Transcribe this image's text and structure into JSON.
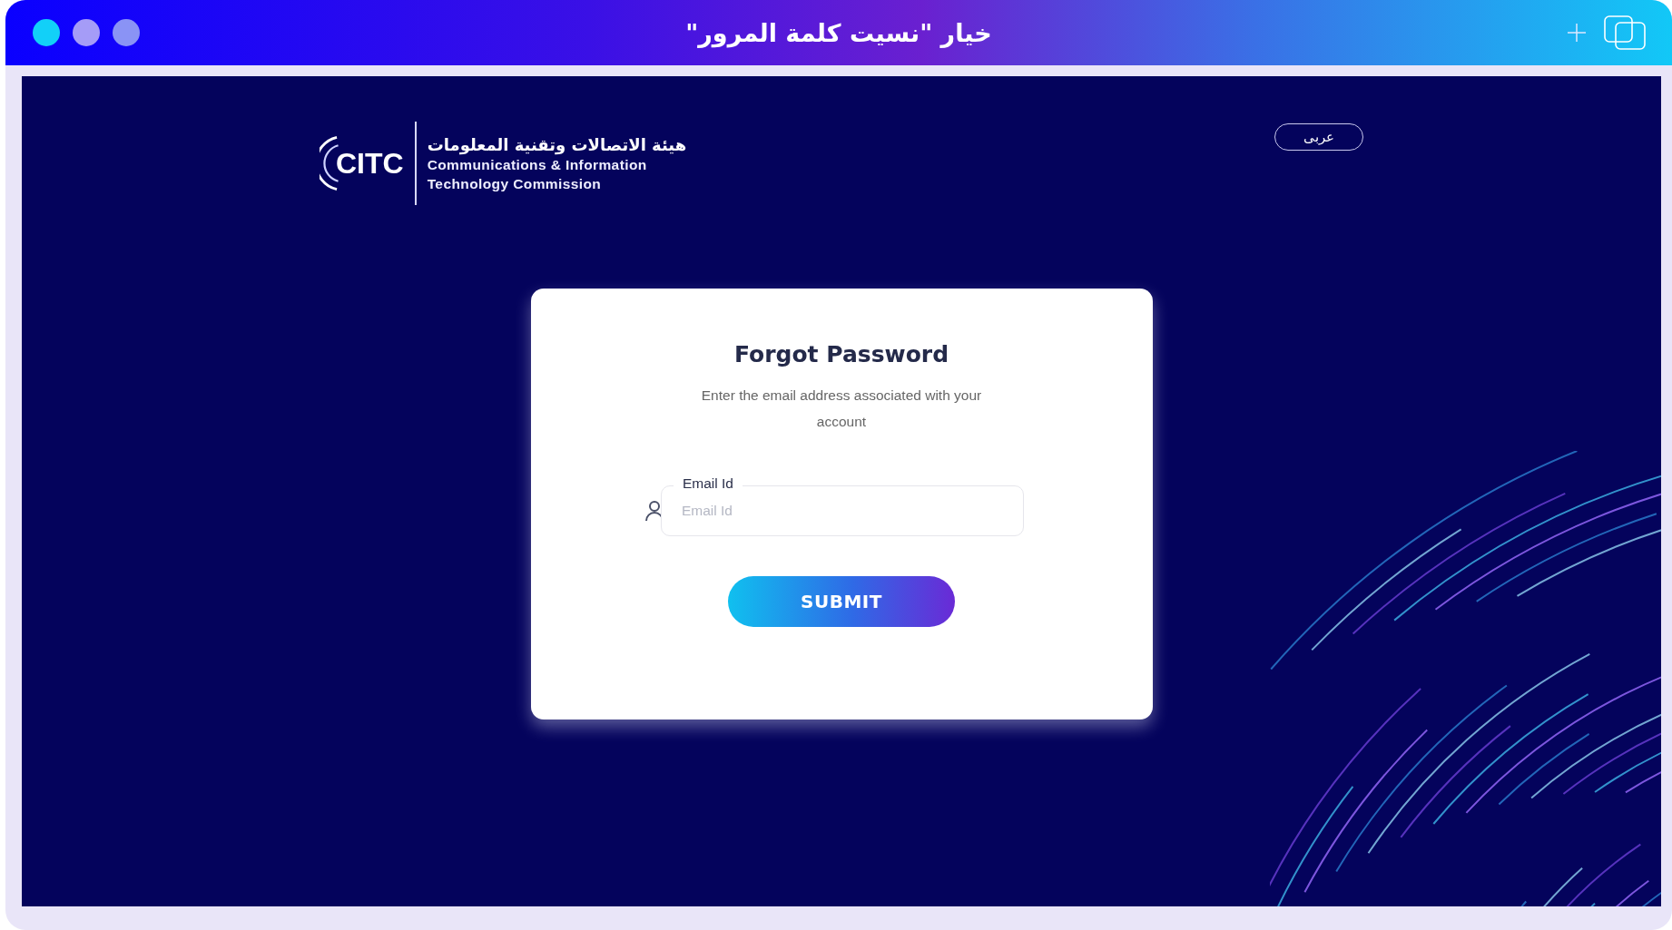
{
  "window": {
    "title": "خيار \"نسيت كلمة المرور\""
  },
  "header": {
    "logo": {
      "mark": "CITC",
      "name_ar": "هيئة الاتصالات وتقنية المعلومات",
      "name_en_line1": "Communications & Information",
      "name_en_line2": "Technology Commission"
    },
    "language_button": "عربى"
  },
  "card": {
    "title": "Forgot Password",
    "subtitle": "Enter the email address associated with your account",
    "email_field": {
      "label": "Email Id",
      "placeholder": "Email Id"
    },
    "submit_button": "SUBMIT"
  }
}
